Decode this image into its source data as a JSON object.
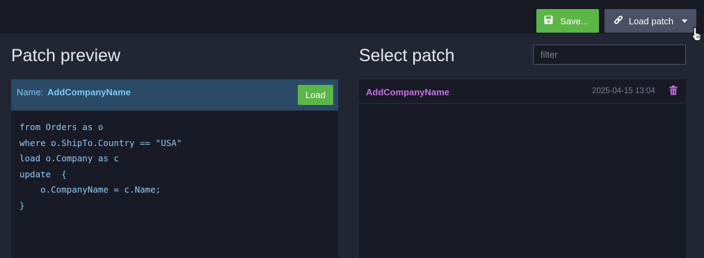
{
  "toolbar": {
    "save_label": "Save...",
    "load_patch_label": "Load patch",
    "colors": {
      "save": "#5cb547",
      "load_patch": "#4b5064"
    }
  },
  "preview": {
    "title": "Patch preview",
    "name_label": "Name:",
    "name_value": "AddCompanyName",
    "load_label": "Load",
    "code_lines": [
      "from Orders as o",
      "where o.ShipTo.Country == \"USA\"",
      "load o.Company as c",
      "update  {",
      "    o.CompanyName = c.Name;",
      "}"
    ]
  },
  "select": {
    "title": "Select patch",
    "filter_placeholder": "filter",
    "filter_value": "",
    "items": [
      {
        "name": "AddCompanyName",
        "date": "2025-04-15 13:04",
        "delete_icon": "trash-icon"
      }
    ]
  }
}
